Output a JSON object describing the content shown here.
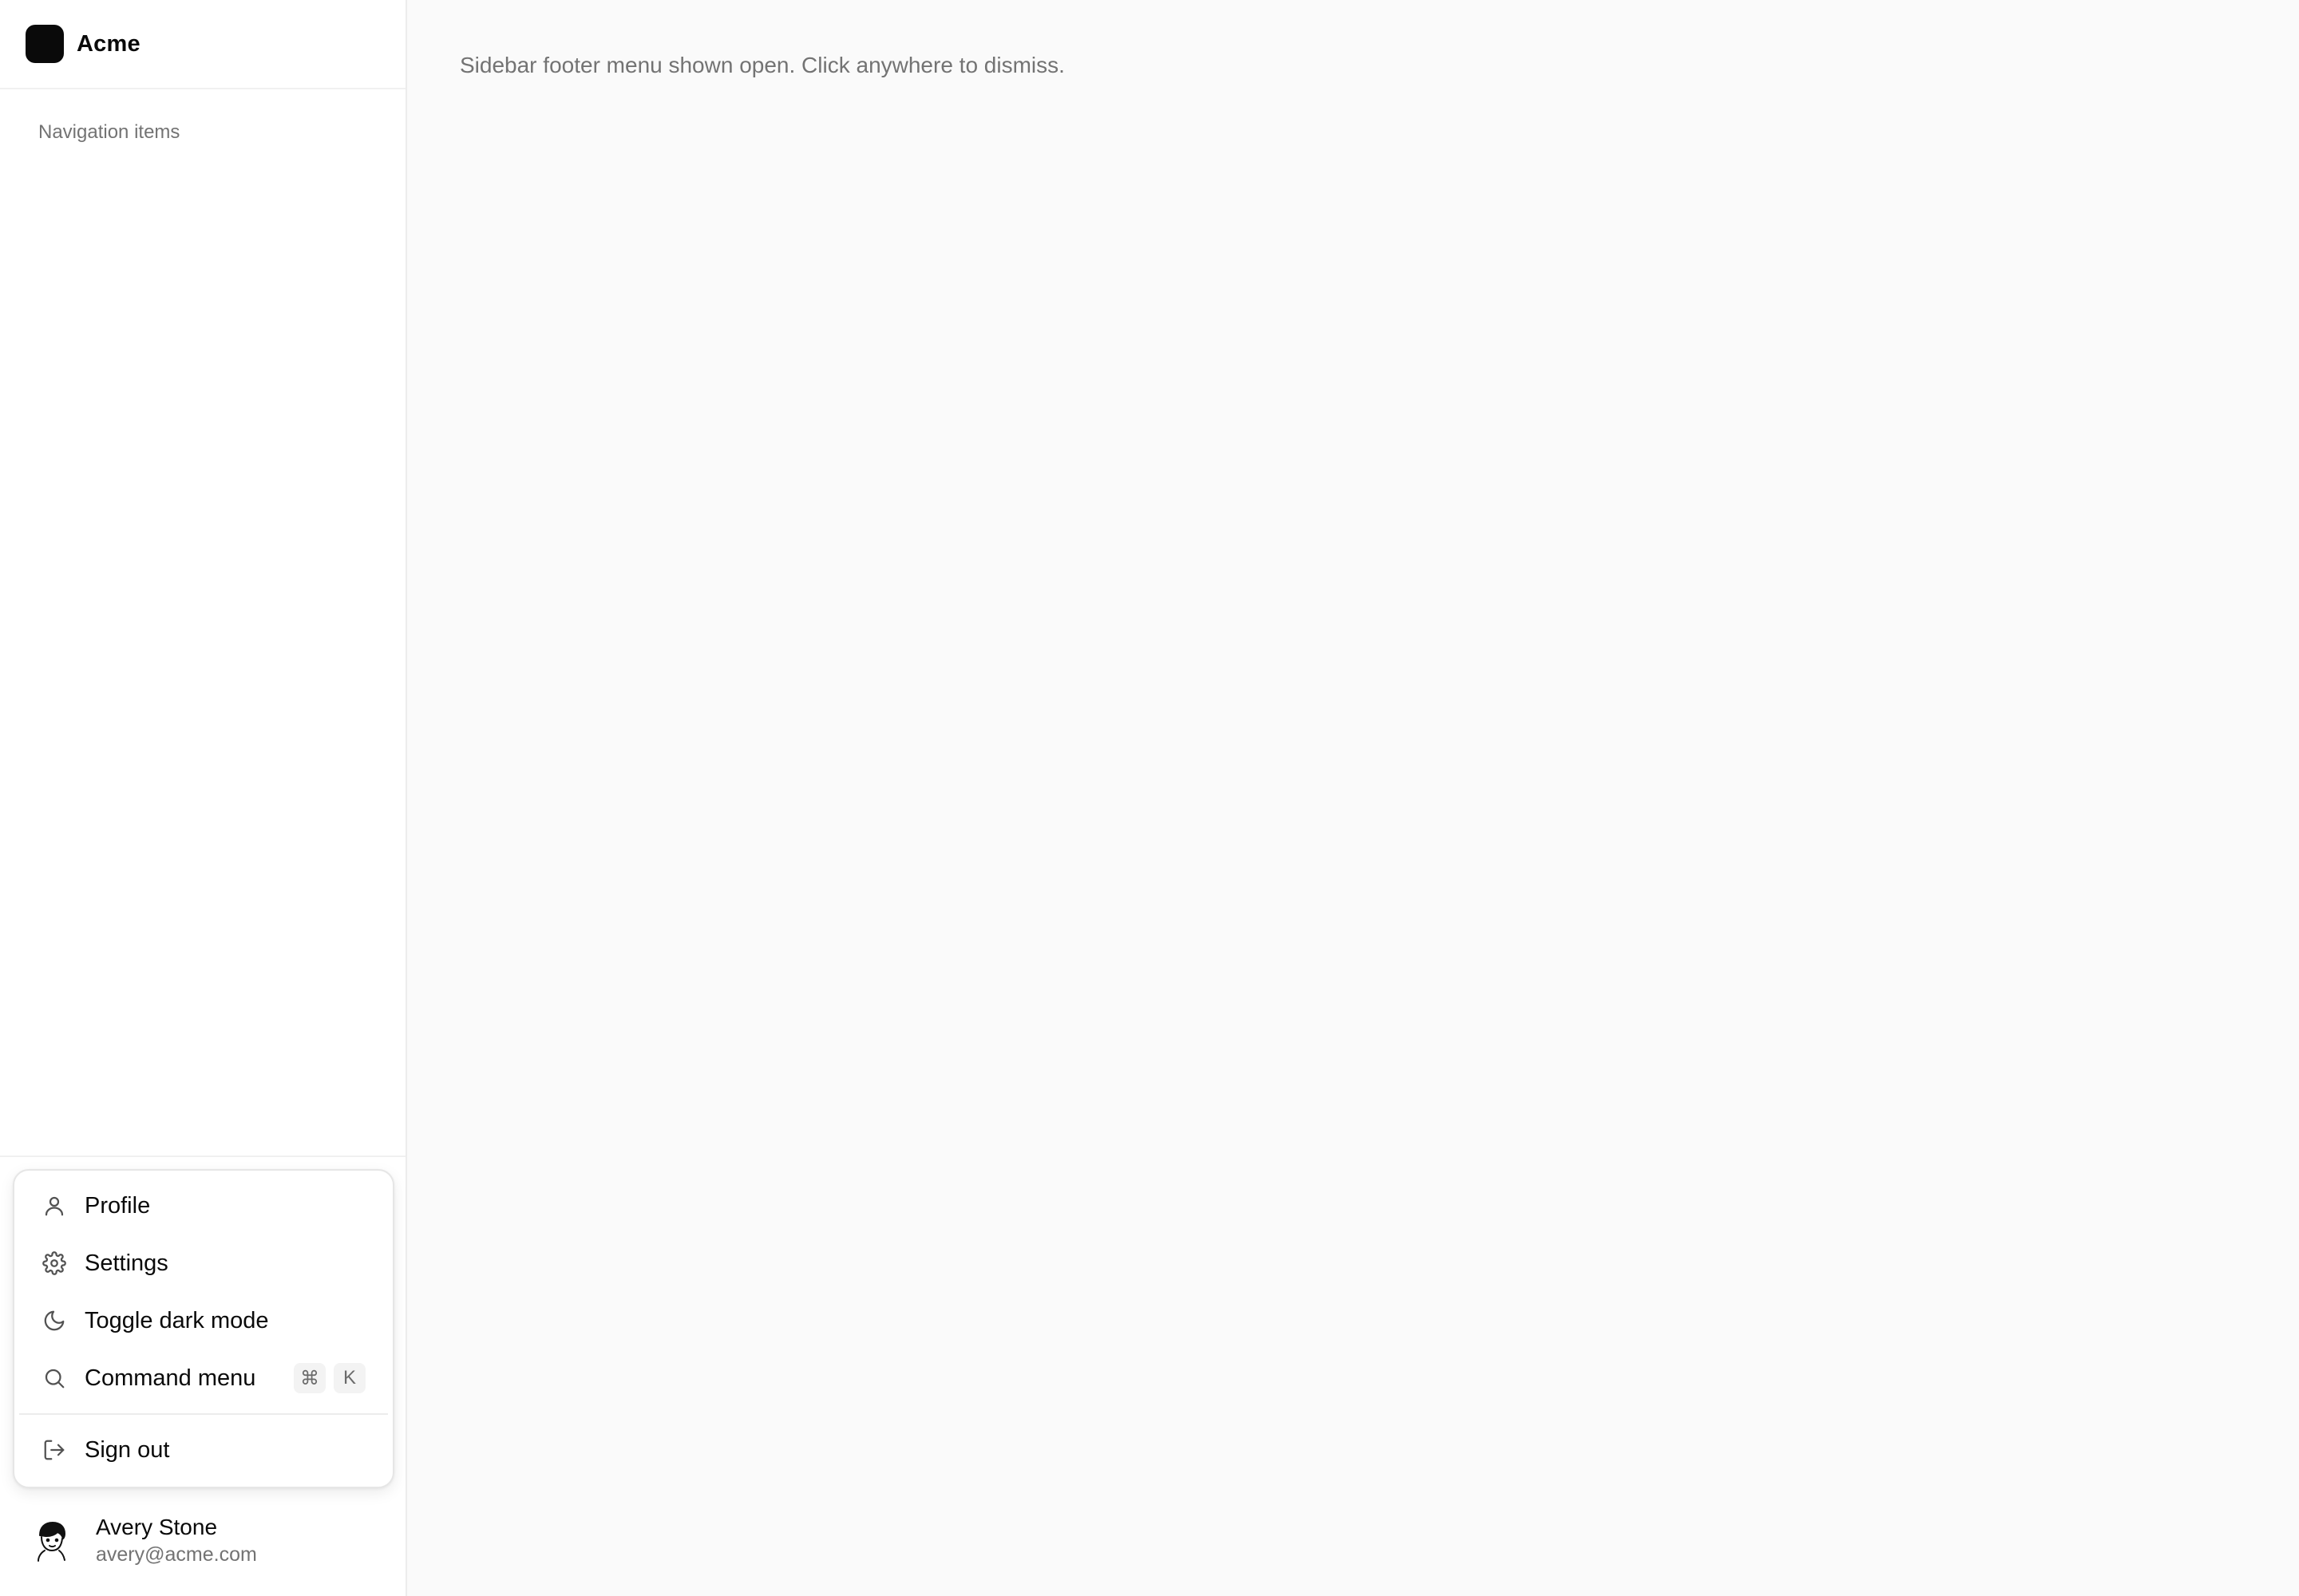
{
  "brand": {
    "name": "Acme",
    "logo_color": "#0a0a0a"
  },
  "sidebar": {
    "nav_heading": "Navigation items"
  },
  "footer_menu": {
    "items": [
      {
        "label": "Profile",
        "icon": "user-icon"
      },
      {
        "label": "Settings",
        "icon": "gear-icon"
      },
      {
        "label": "Toggle dark mode",
        "icon": "moon-icon"
      },
      {
        "label": "Command menu",
        "icon": "search-icon",
        "shortcut": [
          "⌘",
          "K"
        ]
      },
      {
        "label": "Sign out",
        "icon": "sign-out-icon"
      }
    ]
  },
  "user": {
    "name": "Avery Stone",
    "email": "avery@acme.com",
    "avatar": "avatar-illustration"
  },
  "main": {
    "hint": "Sidebar footer menu shown open. Click anywhere to dismiss."
  }
}
